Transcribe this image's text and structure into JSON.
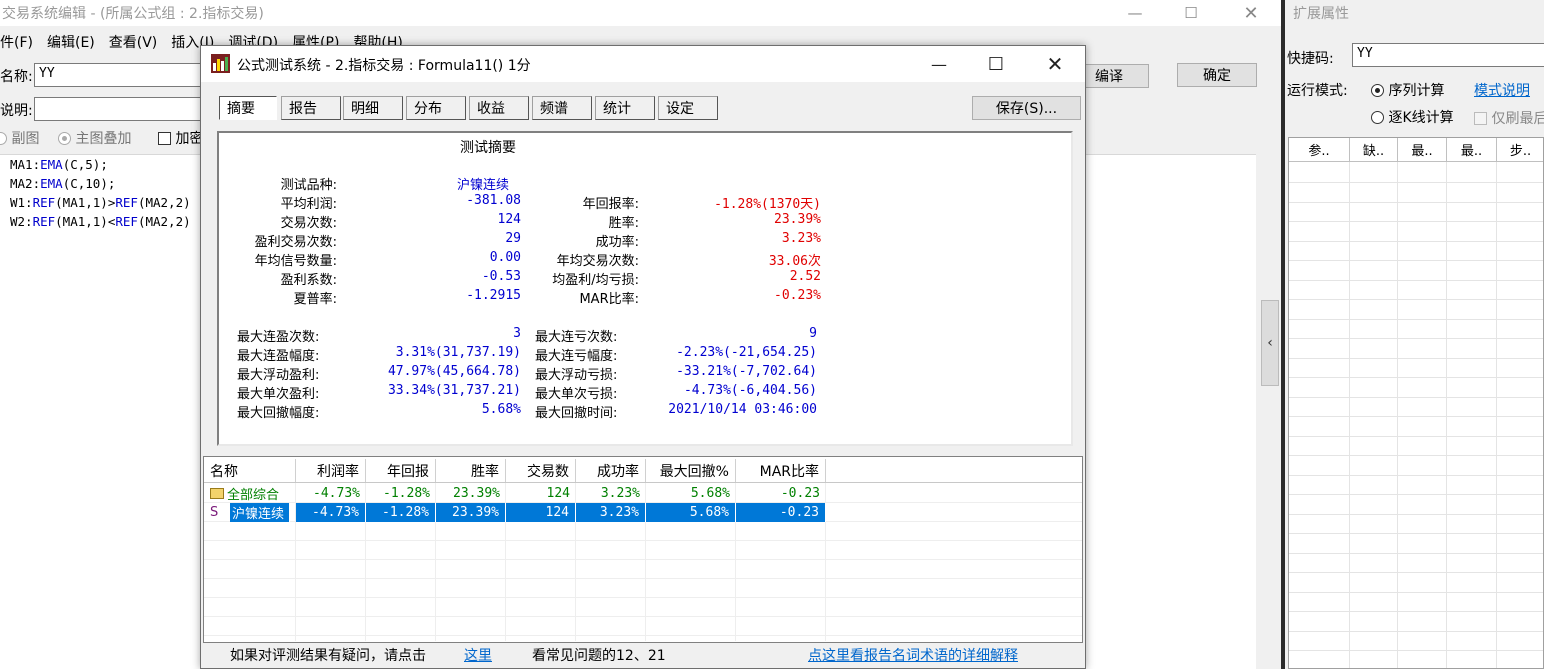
{
  "editor": {
    "title": "交易系统编辑 - (所属公式组 : 2.指标交易)",
    "menu": [
      "件(F)",
      "编辑(E)",
      "查看(V)",
      "插入(I)",
      "调试(D)",
      "属性(P)",
      "帮助(H)"
    ],
    "name_label": "名称:",
    "name_value": "YY",
    "desc_label": "说明:",
    "desc_value": "",
    "opt_subchart": "副图",
    "opt_overlay": "主图叠加",
    "opt_encrypt": "加密",
    "compile_button": "编译",
    "ok_button": "确定",
    "code_lines": [
      [
        {
          "t": "MA1:"
        },
        {
          "t": "EMA",
          "k": 1
        },
        {
          "t": "(C,5);"
        }
      ],
      [
        {
          "t": "MA2:"
        },
        {
          "t": "EMA",
          "k": 1
        },
        {
          "t": "(C,10);"
        }
      ],
      [
        {
          "t": "W1:"
        },
        {
          "t": "REF",
          "k": 1
        },
        {
          "t": "(MA1,1)>"
        },
        {
          "t": "REF",
          "k": 1
        },
        {
          "t": "(MA2,2)"
        }
      ],
      [
        {
          "t": "W2:"
        },
        {
          "t": "REF",
          "k": 1
        },
        {
          "t": "(MA1,1)<"
        },
        {
          "t": "REF",
          "k": 1
        },
        {
          "t": "(MA2,2)"
        }
      ]
    ]
  },
  "right_panel": {
    "title": "扩展属性",
    "shortcut_label": "快捷码:",
    "shortcut_value": "YY",
    "run_mode_label": "运行模式:",
    "mode_seq": "序列计算",
    "mode_desc_link": "模式说明",
    "mode_kline": "逐K线计算",
    "refresh_only": "仅刷最后",
    "grid_headers": [
      "参..",
      "缺..",
      "最..",
      "最..",
      "步.."
    ]
  },
  "dialog": {
    "title": "公式测试系统 - 2.指标交易 : Formula11() 1分",
    "tabs": [
      "摘要",
      "报告",
      "明细",
      "分布",
      "收益",
      "频谱",
      "统计",
      "设定"
    ],
    "save_button": "保存(S)...",
    "summary": {
      "heading": "测试摘要",
      "product_label": "测试品种:",
      "product_value": "沪镍连续",
      "left": [
        {
          "label": "平均利润:",
          "value": "-381.08"
        },
        {
          "label": "交易次数:",
          "value": "124"
        },
        {
          "label": "盈利交易次数:",
          "value": "29"
        },
        {
          "label": "年均信号数量:",
          "value": "0.00"
        },
        {
          "label": "盈利系数:",
          "value": "-0.53"
        },
        {
          "label": "夏普率:",
          "value": "-1.2915"
        }
      ],
      "right": [
        {
          "label": "年回报率:",
          "value": "-1.28%(1370天)",
          "color": "red"
        },
        {
          "label": "胜率:",
          "value": "23.39%",
          "color": "red"
        },
        {
          "label": "成功率:",
          "value": "3.23%",
          "color": "red"
        },
        {
          "label": "年均交易次数:",
          "value": "33.06次",
          "color": "red"
        },
        {
          "label": "均盈利/均亏损:",
          "value": "2.52",
          "color": "red"
        },
        {
          "label": "MAR比率:",
          "value": "-0.23%",
          "color": "red"
        }
      ],
      "left2": [
        {
          "label": "最大连盈次数:",
          "value": "3"
        },
        {
          "label": "最大连盈幅度:",
          "value": "3.31%(31,737.19)"
        },
        {
          "label": "最大浮动盈利:",
          "value": "47.97%(45,664.78)"
        },
        {
          "label": "最大单次盈利:",
          "value": "33.34%(31,737.21)"
        },
        {
          "label": "最大回撤幅度:",
          "value": "5.68%"
        }
      ],
      "right2": [
        {
          "label": "最大连亏次数:",
          "value": "9"
        },
        {
          "label": "最大连亏幅度:",
          "value": "-2.23%(-21,654.25)"
        },
        {
          "label": "最大浮动亏损:",
          "value": "-33.21%(-7,702.64)"
        },
        {
          "label": "最大单次亏损:",
          "value": "-4.73%(-6,404.56)"
        },
        {
          "label": "最大回撤时间:",
          "value": "2021/10/14 03:46:00"
        }
      ]
    },
    "table": {
      "headers": [
        "名称",
        "利润率",
        "年回报",
        "胜率",
        "交易数",
        "成功率",
        "最大回撤%",
        "MAR比率"
      ],
      "rows": [
        {
          "icon": "folder-icon",
          "name": "全部综合",
          "cells": [
            "-4.73%",
            "-1.28%",
            "23.39%",
            "124",
            "3.23%",
            "5.68%",
            "-0.23"
          ]
        },
        {
          "icon": "S",
          "name": "沪镍连续",
          "cells": [
            "-4.73%",
            "-1.28%",
            "23.39%",
            "124",
            "3.23%",
            "5.68%",
            "-0.23"
          ]
        }
      ]
    },
    "status": {
      "text1": "如果对评测结果有疑问，请点击",
      "link1": "这里",
      "text2": "看常见问题的12、21",
      "link2": "点这里看报告名词术语的详细解释"
    }
  }
}
